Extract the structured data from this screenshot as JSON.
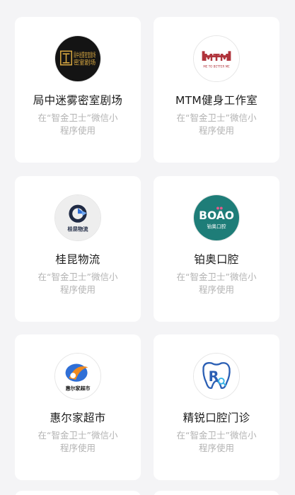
{
  "items": [
    {
      "name": "局中迷雾密室剧场",
      "sub_line1": "在“智金卫士”微信小",
      "sub_line2": "程序使用",
      "logo_text": "局中迷雾密室剧场"
    },
    {
      "name": "MTM健身工作室",
      "sub_line1": "在“智金卫士”微信小",
      "sub_line2": "程序使用",
      "logo_text": "MTM",
      "logo_tagline": "ME TO BETTER ME"
    },
    {
      "name": "桂昆物流",
      "sub_line1": "在“智金卫士”微信小",
      "sub_line2": "程序使用",
      "logo_text": "桂昆物流"
    },
    {
      "name": "铂奥口腔",
      "sub_line1": "在“智金卫士”微信小",
      "sub_line2": "程序使用",
      "logo_text": "BOAO",
      "logo_sub": "铂奥口腔"
    },
    {
      "name": "惠尔家超市",
      "sub_line1": "在“智金卫士”微信小",
      "sub_line2": "程序使用",
      "logo_text": "惠尔家超市"
    },
    {
      "name": "精锐口腔门诊",
      "sub_line1": "在“智金卫士”微信小",
      "sub_line2": "程序使用",
      "logo_text": "R"
    }
  ],
  "colors": {
    "background": "#f4f4f6",
    "card": "#ffffff",
    "title": "#1a1a1a",
    "subtitle": "#b3b3b3",
    "mtm_red": "#b0343c",
    "boao_teal": "#1e7d78",
    "huierjia_orange": "#f08a1e",
    "jingrui_blue": "#2b5fb4"
  },
  "icons": [
    "escape-room-logo-icon",
    "mtm-fitness-logo-icon",
    "guikun-logistics-logo-icon",
    "boao-dental-logo-icon",
    "huierjia-supermarket-logo-icon",
    "jingrui-dental-logo-icon"
  ]
}
